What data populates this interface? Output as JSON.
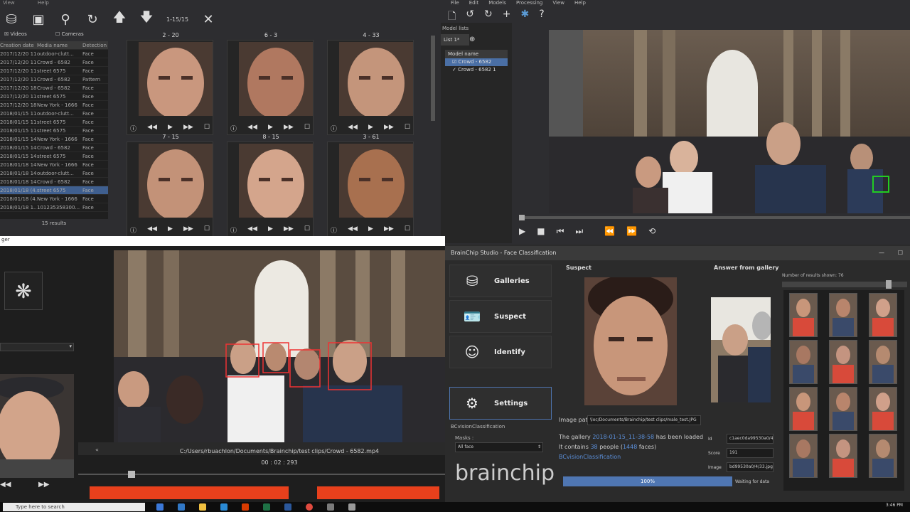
{
  "top_left": {
    "menu": [
      "View",
      "Help"
    ],
    "range_label": "1-15/15",
    "filters": {
      "videos": "Videos",
      "cameras": "Cameras"
    },
    "table": {
      "headers": [
        "Creation date",
        "Media name",
        "Detection"
      ],
      "rows": [
        [
          "2017/12/20 11...",
          "outdoor-clutt...",
          "Face"
        ],
        [
          "2017/12/20 11...",
          "Crowd - 6582",
          "Face"
        ],
        [
          "2017/12/20 11...",
          "street 6575",
          "Face"
        ],
        [
          "2017/12/20 11...",
          "Crowd - 6582",
          "Pattern"
        ],
        [
          "2017/12/20 18...",
          "Crowd - 6582",
          "Face"
        ],
        [
          "2017/12/20 11...",
          "street 6575",
          "Face"
        ],
        [
          "2017/12/20 18...",
          "New York - 1666",
          "Face"
        ],
        [
          "2018/01/15 11...",
          "outdoor-clutt...",
          "Face"
        ],
        [
          "2018/01/15 11...",
          "street 6575",
          "Face"
        ],
        [
          "2018/01/15 11...",
          "street 6575",
          "Face"
        ],
        [
          "2018/01/15 14...",
          "New York - 1666",
          "Face"
        ],
        [
          "2018/01/15 14...",
          "Crowd - 6582",
          "Face"
        ],
        [
          "2018/01/15 14...",
          "street 6575",
          "Face"
        ],
        [
          "2018/01/18 14...",
          "New York - 1666",
          "Face"
        ],
        [
          "2018/01/18 14...",
          "outdoor-clutt...",
          "Face"
        ],
        [
          "2018/01/18 14...",
          "Crowd - 6582",
          "Face"
        ],
        [
          "2018/01/18 (4...",
          "street 6575",
          "Face"
        ],
        [
          "2018/01/18 (4...",
          "New York - 1666",
          "Face"
        ],
        [
          "2018/01/18 1...",
          "101235358300...",
          "Face"
        ]
      ],
      "selected_row": 16
    },
    "results": "15 results",
    "thumbs": [
      {
        "label": "2 - 20"
      },
      {
        "label": "6 - 3"
      },
      {
        "label": "4 - 33"
      },
      {
        "label": "7 - 15"
      },
      {
        "label": "8 - 15"
      },
      {
        "label": "3 - 61"
      }
    ]
  },
  "top_right": {
    "menu": [
      "File",
      "Edit",
      "Models",
      "Processing",
      "View",
      "Help"
    ],
    "model_lists_title": "Model lists",
    "tab": "List 1*",
    "model_header": "Model name",
    "models": [
      "Crowd - 6582",
      "Crowd - 6582 1"
    ]
  },
  "bottom_left": {
    "title": "ger",
    "video_path": "C:/Users/rbuachlon/Documents/Brainchip/test clips/Crowd - 6582.mp4",
    "time": "00 : 02 : 293"
  },
  "bottom_right": {
    "window_title": "BrainChip Studio - Face Classification",
    "nav": [
      {
        "label": "Galleries",
        "icon": "database-icon"
      },
      {
        "label": "Suspect",
        "icon": "id-card-icon"
      },
      {
        "label": "Identify",
        "icon": "person-search-icon"
      },
      {
        "label": "Settings",
        "icon": "gear-icon"
      }
    ],
    "classification_label": "BCvisionClassification",
    "masks_label": "Masks :",
    "masks_value": "All face",
    "suspect_title": "Suspect",
    "answer_title": "Answer from gallery",
    "results_count": "Number of results shown: 76",
    "image_path_label": "Image path",
    "image_path_value": "\\loc/Documents/Brainchip/test clips/male_test.JPG",
    "gallery_msg_1": "The gallery",
    "gallery_date": "2018-01-15_11-38-58",
    "gallery_msg_2": "has been loaded",
    "contains_1": "It contains",
    "people_count": "38",
    "contains_2": "people (",
    "faces_count": "1448",
    "contains_3": "faces)",
    "classifier": "BCvisionClassification",
    "id_label": "Id",
    "id_value": "c1aec0da99530a0/4",
    "score_label": "Score",
    "score_value": "191",
    "image_label": "Image",
    "image_value": "bd99530a0/4/33.jpg",
    "progress_text": "100%",
    "status": "Waiting for data",
    "brand": "brainchip",
    "accent": "#4f76b2"
  },
  "taskbar": {
    "search_placeholder": "Type here to search",
    "time": "3:46 PM"
  }
}
